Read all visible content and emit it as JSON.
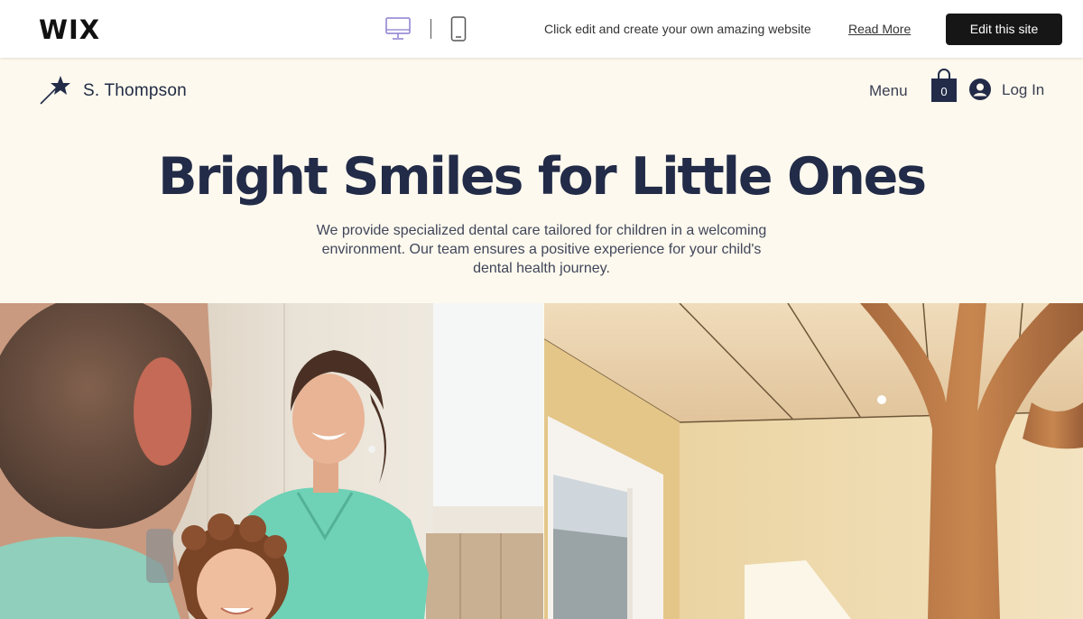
{
  "wix_bar": {
    "logo": "WIX",
    "promo_text": "Click edit and create your own amazing website",
    "read_more": "Read More",
    "edit_button": "Edit this site",
    "icons": [
      "desktop-icon",
      "mobile-icon"
    ]
  },
  "site": {
    "brand_name": "S. Thompson",
    "nav": {
      "menu": "Menu",
      "cart_count": "0",
      "login": "Log In"
    },
    "hero": {
      "title": "Bright Smiles for Little Ones",
      "text": "We provide specialized dental care tailored for children in a welcoming environment. Our team ensures a positive experience for your child's dental health journey."
    }
  },
  "images": {
    "left": "dentist-with-child-photo",
    "right": "clinic-interior-photo"
  },
  "colors": {
    "header_bg": "#fdf9ee",
    "navy": "#222b47",
    "button_dark": "#161616",
    "scrubs": "#6fd1b5"
  }
}
